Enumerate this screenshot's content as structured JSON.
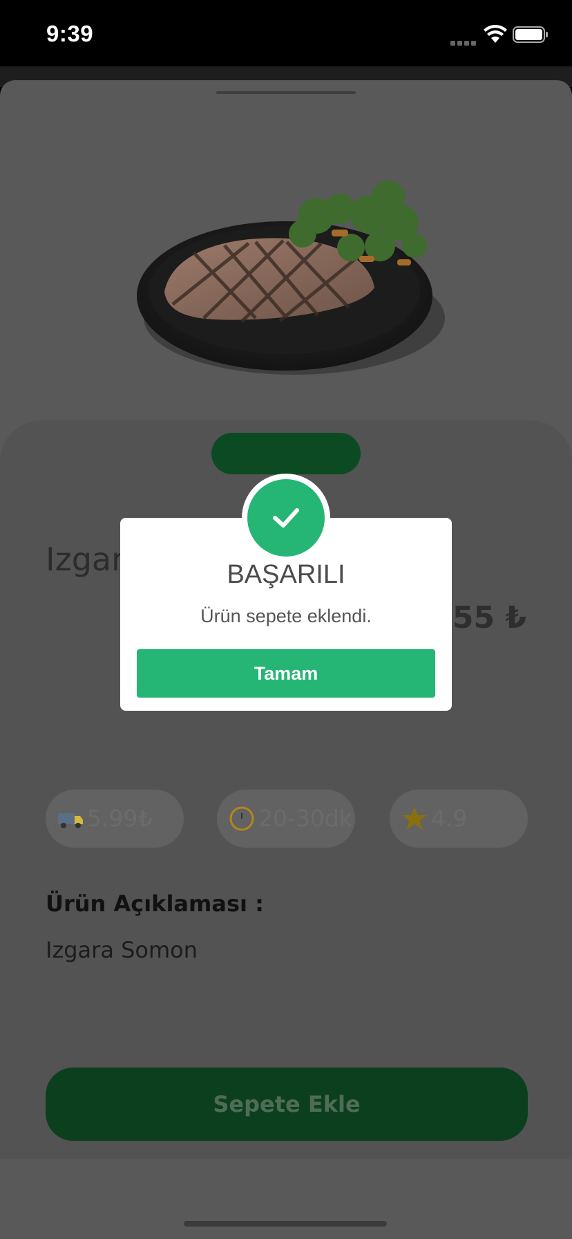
{
  "status_bar": {
    "time": "9:39"
  },
  "product": {
    "title": "Izgara",
    "price": "55 ₺"
  },
  "chips": [
    {
      "icon": "delivery-truck-icon",
      "text": "5.99₺"
    },
    {
      "icon": "clock-icon",
      "text": "20-30dk"
    },
    {
      "icon": "star-icon",
      "text": "4.9"
    }
  ],
  "description": {
    "heading": "Ürün Açıklaması :",
    "text": "Izgara Somon"
  },
  "add_button_label": "Sepete Ekle",
  "dialog": {
    "title": "BAŞARILI",
    "message": "Ürün sepete eklendi.",
    "ok_label": "Tamam"
  },
  "colors": {
    "accent_green": "#25b574",
    "dark_green": "#0c3f1e",
    "overlay_gray": "#595959"
  }
}
